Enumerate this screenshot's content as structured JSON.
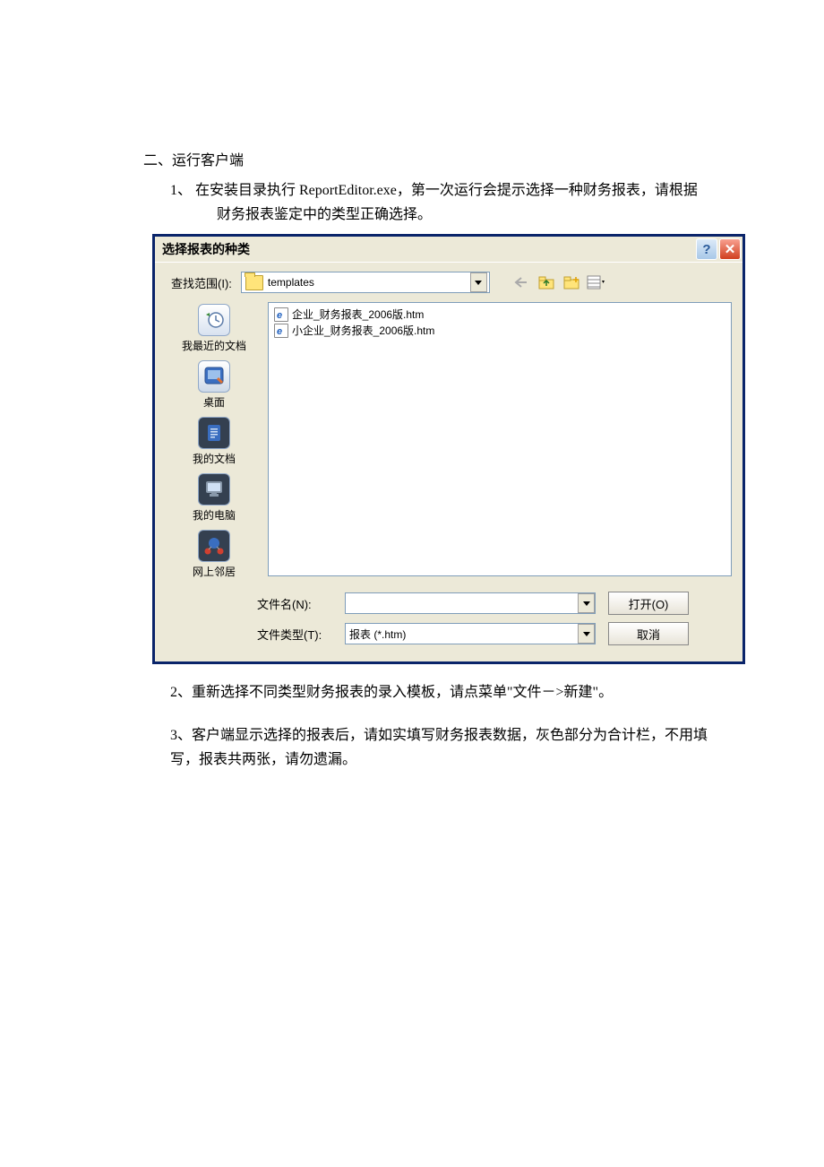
{
  "doc": {
    "section_heading": "二、运行客户端",
    "step1_line1": "1、 在安装目录执行 ReportEditor.exe，第一次运行会提示选择一种财务报表，请根据",
    "step1_line2": "财务报表鉴定中的类型正确选择。",
    "step2": "2、重新选择不同类型财务报表的录入模板，请点菜单\"文件－>新建\"。",
    "step3_line1": "3、客户端显示选择的报表后，请如实填写财务报表数据，灰色部分为合计栏，不用填",
    "step3_line2": "写，报表共两张，请勿遗漏。"
  },
  "dialog": {
    "title": "选择报表的种类",
    "lookin_label": "查找范围(I):",
    "lookin_value": "templates",
    "sidebar": [
      {
        "label": "我最近的文档"
      },
      {
        "label": "桌面"
      },
      {
        "label": "我的文档"
      },
      {
        "label": "我的电脑"
      },
      {
        "label": "网上邻居"
      }
    ],
    "files": [
      "企业_财务报表_2006版.htm",
      "小企业_财务报表_2006版.htm"
    ],
    "filename_label": "文件名(N):",
    "filename_value": "",
    "filetype_label": "文件类型(T):",
    "filetype_value": "报表 (*.htm)",
    "open_btn": "打开(O)",
    "cancel_btn": "取消",
    "help_char": "?",
    "close_char": "✕"
  }
}
